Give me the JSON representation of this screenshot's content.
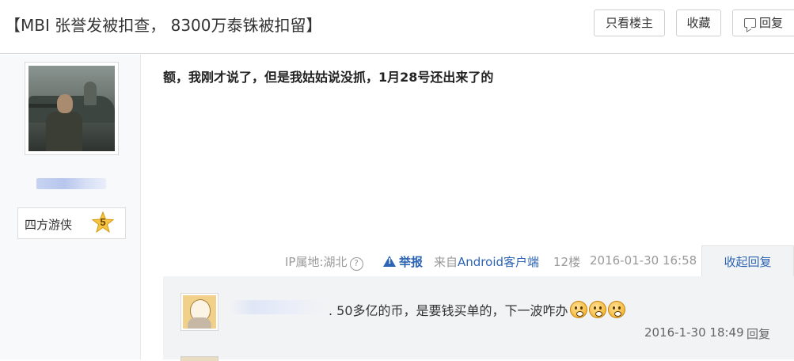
{
  "header": {
    "title": "【MBI 张誉发被扣查， 8300万泰铢被扣留】",
    "buttons": {
      "only_op": "只看楼主",
      "collect": "收藏",
      "reply": "回复"
    }
  },
  "author": {
    "rank_title": "四方游侠",
    "level": "5"
  },
  "post": {
    "content": "额，我刚才说了，但是我姑姑说没抓，1月28号还出来了的",
    "ip_location": "IP属地:湖北",
    "report": "举报",
    "source_prefix": "来自",
    "source_device": "Android客户端",
    "floor": "12楼",
    "time": "2016-01-30 16:58",
    "collapse_replies": "收起回复"
  },
  "sub_reply": {
    "text": ". 50多亿的币，是要钱买单的，下一波咋办",
    "time": "2016-1-30 18:49",
    "reply": "回复"
  },
  "icons": {
    "question": "help-circle-icon",
    "report": "warning-triangle-icon",
    "reply": "comment-icon",
    "level": "star-badge-icon",
    "emoji": "worried-face-emoji"
  },
  "colors": {
    "link_blue": "#2d64b3",
    "left_column_bg": "#f7f9fb",
    "reply_area_bg": "#f2f3f5"
  }
}
